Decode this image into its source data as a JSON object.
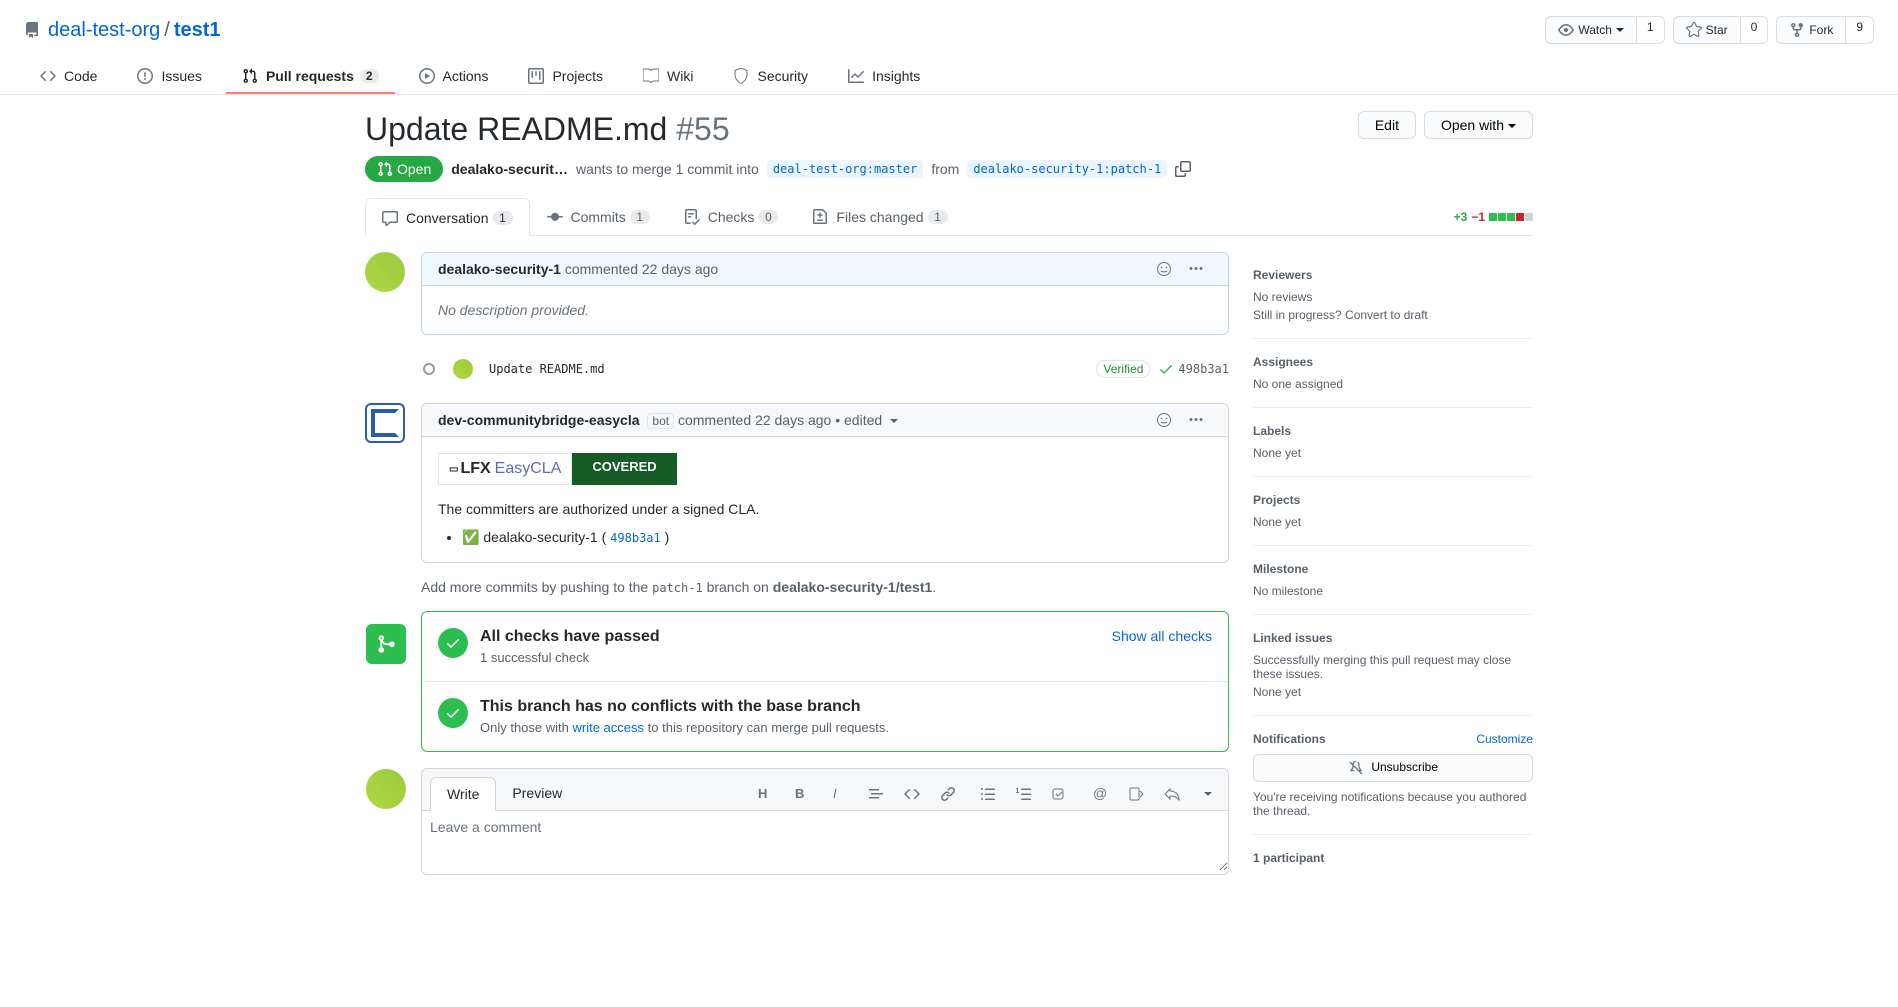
{
  "repo": {
    "org": "deal-test-org",
    "name": "test1"
  },
  "repo_actions": {
    "watch": "Watch",
    "watch_count": "1",
    "star": "Star",
    "star_count": "0",
    "fork": "Fork",
    "fork_count": "9"
  },
  "nav": {
    "code": "Code",
    "issues": "Issues",
    "pulls": "Pull requests",
    "pulls_count": "2",
    "actions": "Actions",
    "projects": "Projects",
    "wiki": "Wiki",
    "security": "Security",
    "insights": "Insights"
  },
  "pr": {
    "title": "Update README.md",
    "number": "#55",
    "edit": "Edit",
    "open_with": "Open with",
    "state": "Open",
    "author": "dealako-securit…",
    "merge_text": "wants to merge 1 commit into",
    "base": "deal-test-org:master",
    "from": "from",
    "head": "dealako-security-1:patch-1"
  },
  "pr_tabs": {
    "conversation": "Conversation",
    "conversation_count": "1",
    "commits": "Commits",
    "commits_count": "1",
    "checks": "Checks",
    "checks_count": "0",
    "files": "Files changed",
    "files_count": "1"
  },
  "diffstat": {
    "additions": "+3",
    "deletions": "−1"
  },
  "comment1": {
    "author": "dealako-security-1",
    "action": "commented",
    "time": "22 days ago",
    "body": "No description provided."
  },
  "commit": {
    "msg": "Update README.md",
    "verified": "Verified",
    "sha": "498b3a1"
  },
  "comment2": {
    "author": "dev-communitybridge-easycla",
    "bot": "bot",
    "action": "commented",
    "time": "22 days ago",
    "edited": "edited",
    "covered": "COVERED",
    "lfx": "LFX",
    "easy": "EasyCLA",
    "body": "The committers are authorized under a signed CLA.",
    "list_prefix": "✅ ",
    "list_author": "dealako-security-1",
    "list_sha": "498b3a1"
  },
  "push_hint": {
    "prefix": "Add more commits by pushing to the ",
    "branch": "patch-1",
    "mid": " branch on ",
    "repo": "dealako-security-1/test1",
    "suffix": "."
  },
  "merge": {
    "checks_title": "All checks have passed",
    "checks_sub": "1 successful check",
    "show_all": "Show all checks",
    "conflict_title": "This branch has no conflicts with the base branch",
    "conflict_sub_pre": "Only those with ",
    "conflict_link": "write access",
    "conflict_sub_post": " to this repository can merge pull requests."
  },
  "form": {
    "write": "Write",
    "preview": "Preview",
    "placeholder": "Leave a comment"
  },
  "side": {
    "reviewers": "Reviewers",
    "reviewers_none": "No reviews",
    "reviewers_draft": "Still in progress? Convert to draft",
    "assignees": "Assignees",
    "assignees_none": "No one assigned",
    "labels": "Labels",
    "labels_none": "None yet",
    "projects": "Projects",
    "projects_none": "None yet",
    "milestone": "Milestone",
    "milestone_none": "No milestone",
    "linked": "Linked issues",
    "linked_desc": "Successfully merging this pull request may close these issues.",
    "linked_none": "None yet",
    "notifications": "Notifications",
    "customize": "Customize",
    "unsubscribe": "Unsubscribe",
    "notif_desc": "You're receiving notifications because you authored the thread.",
    "participants": "1 participant"
  }
}
